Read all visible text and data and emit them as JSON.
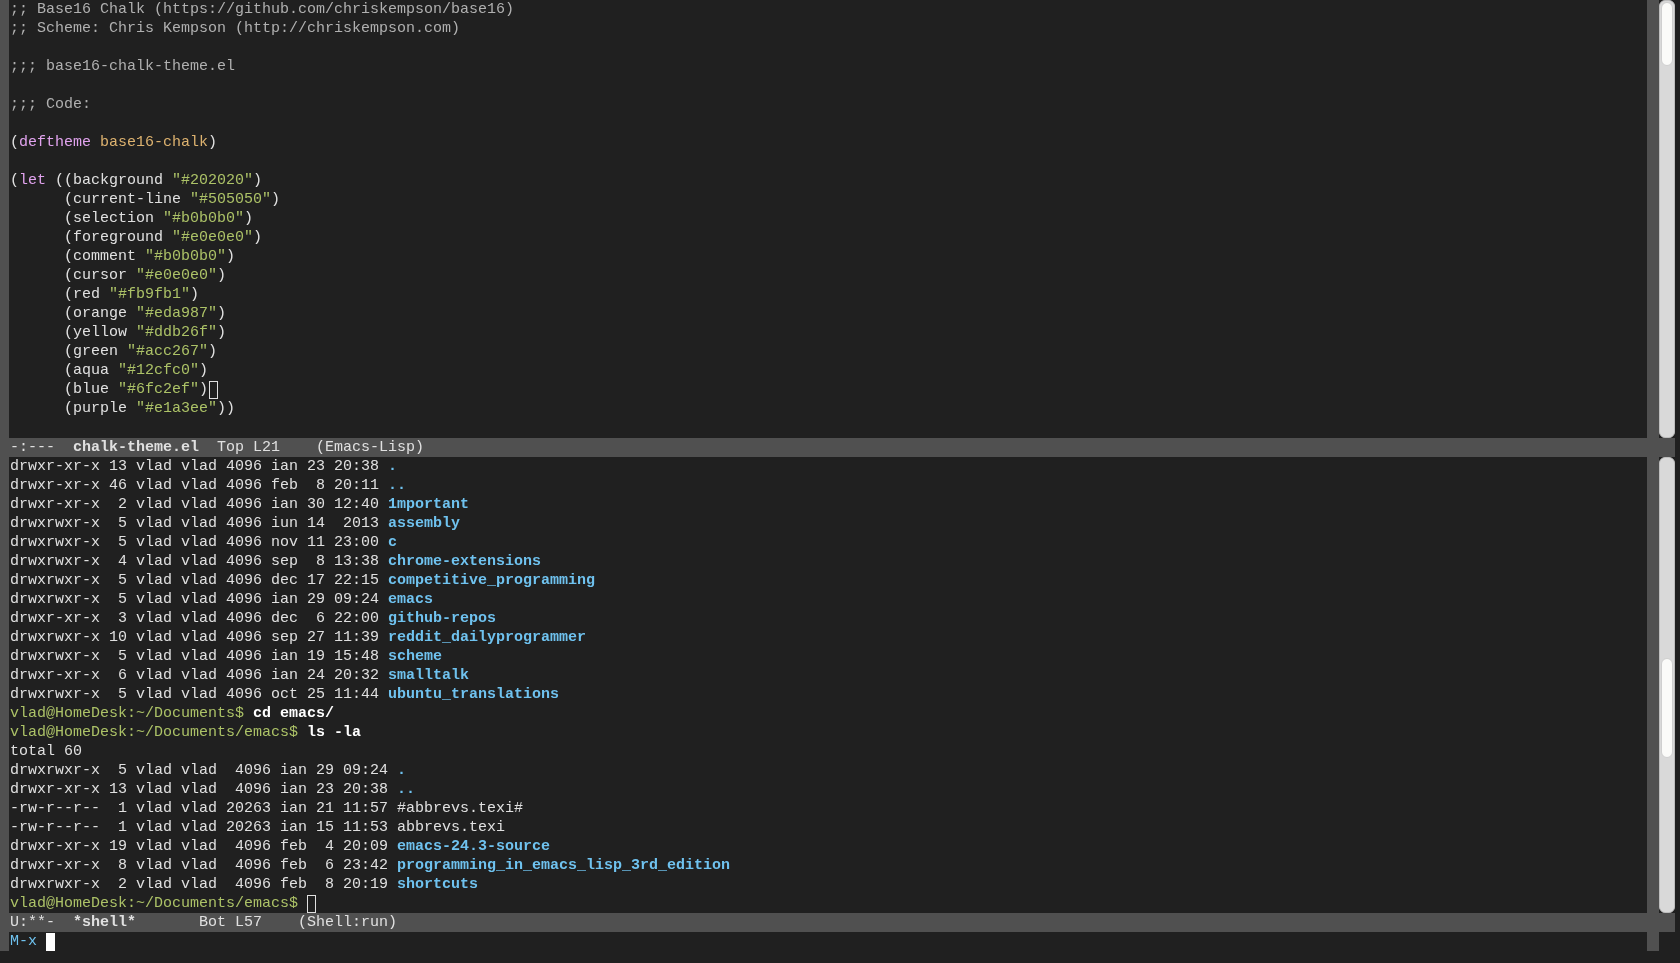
{
  "editor_window": {
    "lines": [
      {
        "kind": "code",
        "tokens": [
          {
            "text": ";; Base16 Chalk (https://github.com/chriskempson/base16)",
            "kind": "comment"
          }
        ]
      },
      {
        "kind": "code",
        "tokens": [
          {
            "text": ";; Scheme: Chris Kempson (http://chriskempson.com)",
            "kind": "comment"
          }
        ]
      },
      {
        "kind": "blank"
      },
      {
        "kind": "code",
        "tokens": [
          {
            "text": ";;; base16-chalk-theme.el",
            "kind": "comment"
          }
        ]
      },
      {
        "kind": "blank"
      },
      {
        "kind": "code",
        "tokens": [
          {
            "text": ";;; Code:",
            "kind": "comment"
          }
        ]
      },
      {
        "kind": "blank"
      },
      {
        "kind": "code",
        "tokens": [
          {
            "text": "(",
            "kind": "plain"
          },
          {
            "text": "deftheme",
            "kind": "keyword"
          },
          {
            "text": " base16-chalk",
            "kind": "name"
          },
          {
            "text": ")",
            "kind": "plain"
          }
        ]
      },
      {
        "kind": "blank"
      },
      {
        "kind": "code",
        "tokens": [
          {
            "text": "(",
            "kind": "plain"
          },
          {
            "text": "let",
            "kind": "keyword"
          },
          {
            "text": " ((background ",
            "kind": "plain"
          },
          {
            "text": "\"#202020\"",
            "kind": "string"
          },
          {
            "text": ")",
            "kind": "plain"
          }
        ]
      },
      {
        "kind": "code",
        "tokens": [
          {
            "text": "      (current-line ",
            "kind": "plain"
          },
          {
            "text": "\"#505050\"",
            "kind": "string"
          },
          {
            "text": ")",
            "kind": "plain"
          }
        ]
      },
      {
        "kind": "code",
        "tokens": [
          {
            "text": "      (selection ",
            "kind": "plain"
          },
          {
            "text": "\"#b0b0b0\"",
            "kind": "string"
          },
          {
            "text": ")",
            "kind": "plain"
          }
        ]
      },
      {
        "kind": "code",
        "tokens": [
          {
            "text": "      (foreground ",
            "kind": "plain"
          },
          {
            "text": "\"#e0e0e0\"",
            "kind": "string"
          },
          {
            "text": ")",
            "kind": "plain"
          }
        ]
      },
      {
        "kind": "code",
        "tokens": [
          {
            "text": "      (comment ",
            "kind": "plain"
          },
          {
            "text": "\"#b0b0b0\"",
            "kind": "string"
          },
          {
            "text": ")",
            "kind": "plain"
          }
        ]
      },
      {
        "kind": "code",
        "tokens": [
          {
            "text": "      (cursor ",
            "kind": "plain"
          },
          {
            "text": "\"#e0e0e0\"",
            "kind": "string"
          },
          {
            "text": ")",
            "kind": "plain"
          }
        ]
      },
      {
        "kind": "code",
        "tokens": [
          {
            "text": "      (red ",
            "kind": "plain"
          },
          {
            "text": "\"#fb9fb1\"",
            "kind": "string"
          },
          {
            "text": ")",
            "kind": "plain"
          }
        ]
      },
      {
        "kind": "code",
        "tokens": [
          {
            "text": "      (orange ",
            "kind": "plain"
          },
          {
            "text": "\"#eda987\"",
            "kind": "string"
          },
          {
            "text": ")",
            "kind": "plain"
          }
        ]
      },
      {
        "kind": "code",
        "tokens": [
          {
            "text": "      (yellow ",
            "kind": "plain"
          },
          {
            "text": "\"#ddb26f\"",
            "kind": "string"
          },
          {
            "text": ")",
            "kind": "plain"
          }
        ]
      },
      {
        "kind": "code",
        "tokens": [
          {
            "text": "      (green ",
            "kind": "plain"
          },
          {
            "text": "\"#acc267\"",
            "kind": "string"
          },
          {
            "text": ")",
            "kind": "plain"
          }
        ]
      },
      {
        "kind": "code",
        "tokens": [
          {
            "text": "      (aqua ",
            "kind": "plain"
          },
          {
            "text": "\"#12cfc0\"",
            "kind": "string"
          },
          {
            "text": ")",
            "kind": "plain"
          }
        ]
      },
      {
        "kind": "code",
        "cursor": {
          "kind": "hollow"
        },
        "tokens": [
          {
            "text": "      (blue ",
            "kind": "plain"
          },
          {
            "text": "\"#6fc2ef\"",
            "kind": "string"
          },
          {
            "text": ")",
            "kind": "plain"
          }
        ]
      },
      {
        "kind": "code",
        "tokens": [
          {
            "text": "      (purple ",
            "kind": "plain"
          },
          {
            "text": "\"#e1a3ee\"",
            "kind": "string"
          },
          {
            "text": "))",
            "kind": "plain"
          }
        ]
      }
    ],
    "mode_line": {
      "status": "-:---",
      "buffer": "chalk-theme.el",
      "position": "Top L21",
      "mode": "(Emacs-Lisp)"
    }
  },
  "shell_window": {
    "lines": [
      {
        "kind": "dir_entry",
        "meta": "drwxr-xr-x 13 vlad vlad 4096 ian 23 20:38",
        "name": "."
      },
      {
        "kind": "dir_entry",
        "meta": "drwxr-xr-x 46 vlad vlad 4096 feb  8 20:11",
        "name": ".."
      },
      {
        "kind": "dir_entry",
        "meta": "drwxr-xr-x  2 vlad vlad 4096 ian 30 12:40",
        "name": "1mportant"
      },
      {
        "kind": "dir_entry",
        "meta": "drwxrwxr-x  5 vlad vlad 4096 iun 14  2013",
        "name": "assembly"
      },
      {
        "kind": "dir_entry",
        "meta": "drwxrwxr-x  5 vlad vlad 4096 nov 11 23:00",
        "name": "c"
      },
      {
        "kind": "dir_entry",
        "meta": "drwxrwxr-x  4 vlad vlad 4096 sep  8 13:38",
        "name": "chrome-extensions"
      },
      {
        "kind": "dir_entry",
        "meta": "drwxrwxr-x  5 vlad vlad 4096 dec 17 22:15",
        "name": "competitive_programming"
      },
      {
        "kind": "dir_entry",
        "meta": "drwxrwxr-x  5 vlad vlad 4096 ian 29 09:24",
        "name": "emacs"
      },
      {
        "kind": "dir_entry",
        "meta": "drwxr-xr-x  3 vlad vlad 4096 dec  6 22:00",
        "name": "github-repos"
      },
      {
        "kind": "dir_entry",
        "meta": "drwxrwxr-x 10 vlad vlad 4096 sep 27 11:39",
        "name": "reddit_dailyprogrammer"
      },
      {
        "kind": "dir_entry",
        "meta": "drwxrwxr-x  5 vlad vlad 4096 ian 19 15:48",
        "name": "scheme"
      },
      {
        "kind": "dir_entry",
        "meta": "drwxr-xr-x  6 vlad vlad 4096 ian 24 20:32",
        "name": "smalltalk"
      },
      {
        "kind": "dir_entry",
        "meta": "drwxrwxr-x  5 vlad vlad 4096 oct 25 11:44",
        "name": "ubuntu_translations"
      },
      {
        "kind": "prompt",
        "prompt": "vlad@HomeDesk:~/Documents$",
        "command": "cd emacs/"
      },
      {
        "kind": "prompt",
        "prompt": "vlad@HomeDesk:~/Documents/emacs$",
        "command": "ls -la"
      },
      {
        "kind": "output",
        "text": "total 60"
      },
      {
        "kind": "dir_entry",
        "meta": "drwxrwxr-x  5 vlad vlad  4096 ian 29 09:24",
        "name": "."
      },
      {
        "kind": "dir_entry",
        "meta": "drwxr-xr-x 13 vlad vlad  4096 ian 23 20:38",
        "name": ".."
      },
      {
        "kind": "file_entry",
        "meta": "-rw-r--r--  1 vlad vlad 20263 ian 21 11:57",
        "name": "#abbrevs.texi#"
      },
      {
        "kind": "file_entry",
        "meta": "-rw-r--r--  1 vlad vlad 20263 ian 15 11:53",
        "name": "abbrevs.texi"
      },
      {
        "kind": "dir_entry",
        "meta": "drwxr-xr-x 19 vlad vlad  4096 feb  4 20:09",
        "name": "emacs-24.3-source"
      },
      {
        "kind": "dir_entry",
        "meta": "drwxr-xr-x  8 vlad vlad  4096 feb  6 23:42",
        "name": "programming_in_emacs_lisp_3rd_edition"
      },
      {
        "kind": "dir_entry",
        "meta": "drwxrwxr-x  2 vlad vlad  4096 feb  8 20:19",
        "name": "shortcuts"
      },
      {
        "kind": "prompt",
        "prompt": "vlad@HomeDesk:~/Documents/emacs$",
        "cursor": {
          "kind": "hollow"
        }
      }
    ],
    "mode_line": {
      "status": "U:**-",
      "buffer": "*shell*",
      "position": "Bot L57",
      "mode": "(Shell:run)"
    }
  },
  "minibuffer": {
    "prompt": "M-x",
    "cursor": {
      "kind": "block"
    }
  }
}
